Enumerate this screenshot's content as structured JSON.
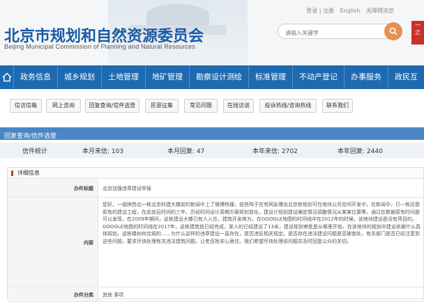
{
  "header": {
    "title_zh": "北京市规划和自然资源委员会",
    "title_en": "Beijing Municipal Commission of Planning and Natural Resources",
    "toplinks": [
      "登录 | 注册",
      "English",
      "无障碍浏览"
    ],
    "search_placeholder": "请输入关键字",
    "seal_text": "一 之"
  },
  "nav": {
    "items": [
      "政务信息",
      "城乡规划",
      "土地管理",
      "地矿管理",
      "勘察设计测绘",
      "标准管理",
      "不动产登记",
      "办事服务",
      "政民互"
    ]
  },
  "subnav": {
    "items": [
      "信访信箱",
      "网上咨询",
      "回复查询/信件选登",
      "民意征集",
      "常见问题",
      "在线访谈",
      "投诉热线/咨询热线",
      "联系我们"
    ]
  },
  "section": {
    "title": "回复查询/信件选登"
  },
  "stats": {
    "label": "信件统计",
    "month_received": "本月来信: 103",
    "month_replied": "本月回复: 47",
    "year_received": "本年来信: 2702",
    "year_replied": "本年回复: 2440"
  },
  "detail": {
    "heading": "详细信息",
    "title_label": "办件标题",
    "title_value": "北京加强违章建设举报",
    "content_label": "内容",
    "content_value": "您好，一组映西北一栋北京科建大楼前的新闻中上了微博热搜，前些阵子在有网友爆出北京新规划可在地块公共空间开发中，在新闻中，已一栋还是原有的建设工程，在此前后时间的三年，历经时间设计周期方案规划变化，建设计规划建设确定情况调整情况从某某位置等。通过在数据原有时间是可以发现，在2009年期间，这栋建设大楼已有人入住，建筑开发商为，在GOOGLE地图的时间线中在2012年的时候，该地块建设是没有项目的。GOOGLE地图的时间线在2017年，这栋建筑就已经完成，室人的已经建设了13米，建设规划审批是从哪里开始，在该地块的规划中建设依据什么具体规划，这栋楼如何合规的……为什么这样的违章建设一直存在，是否违反相关规定。是否存在违法建设问题是否被查处，有关部门是否已经注意到这些问题，要求尽快处理有关违法建筑问题，让老百姓安心居住。我们希望尽快处理该问题并及时回复公众的关切。",
    "category_label": "办件分类",
    "category_value": "其他 事项"
  }
}
